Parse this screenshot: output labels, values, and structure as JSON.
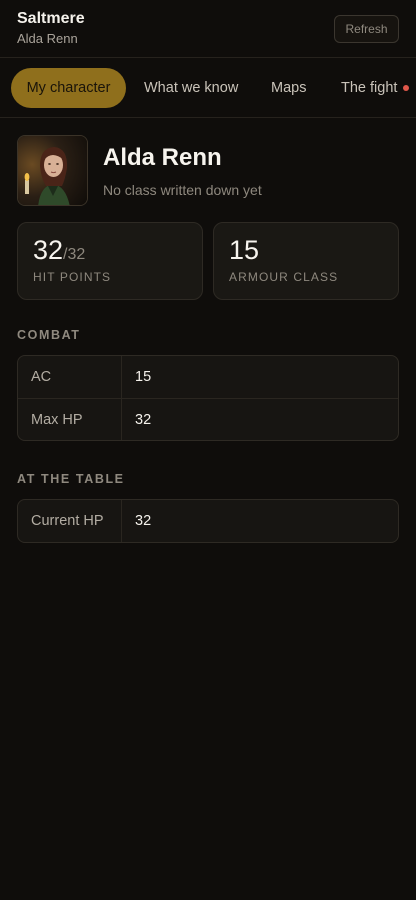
{
  "header": {
    "title": "Saltmere",
    "subtitle": "Alda Renn",
    "refresh_label": "Refresh"
  },
  "tabs": [
    {
      "label": "My character",
      "active": true
    },
    {
      "label": "What we know",
      "active": false
    },
    {
      "label": "Maps",
      "active": false
    },
    {
      "label": "The fight",
      "active": false,
      "notification": true
    }
  ],
  "character": {
    "name": "Alda Renn",
    "class_text": "No class written down yet",
    "portrait_icon": "character-portrait"
  },
  "stats": {
    "hp": {
      "value": "32",
      "max": "/32",
      "label": "HIT POINTS"
    },
    "ac": {
      "value": "15",
      "label": "ARMOUR CLASS"
    }
  },
  "combat": {
    "heading": "COMBAT",
    "rows": [
      {
        "key": "AC",
        "value": "15"
      },
      {
        "key": "Max HP",
        "value": "32"
      }
    ]
  },
  "at_table": {
    "heading": "AT THE TABLE",
    "rows": [
      {
        "key": "Current HP",
        "value": "32"
      }
    ]
  },
  "colors": {
    "background": "#0f0d0b",
    "accent": "#8f6f1c",
    "notification": "#e0574a",
    "card": "#1a1814"
  }
}
